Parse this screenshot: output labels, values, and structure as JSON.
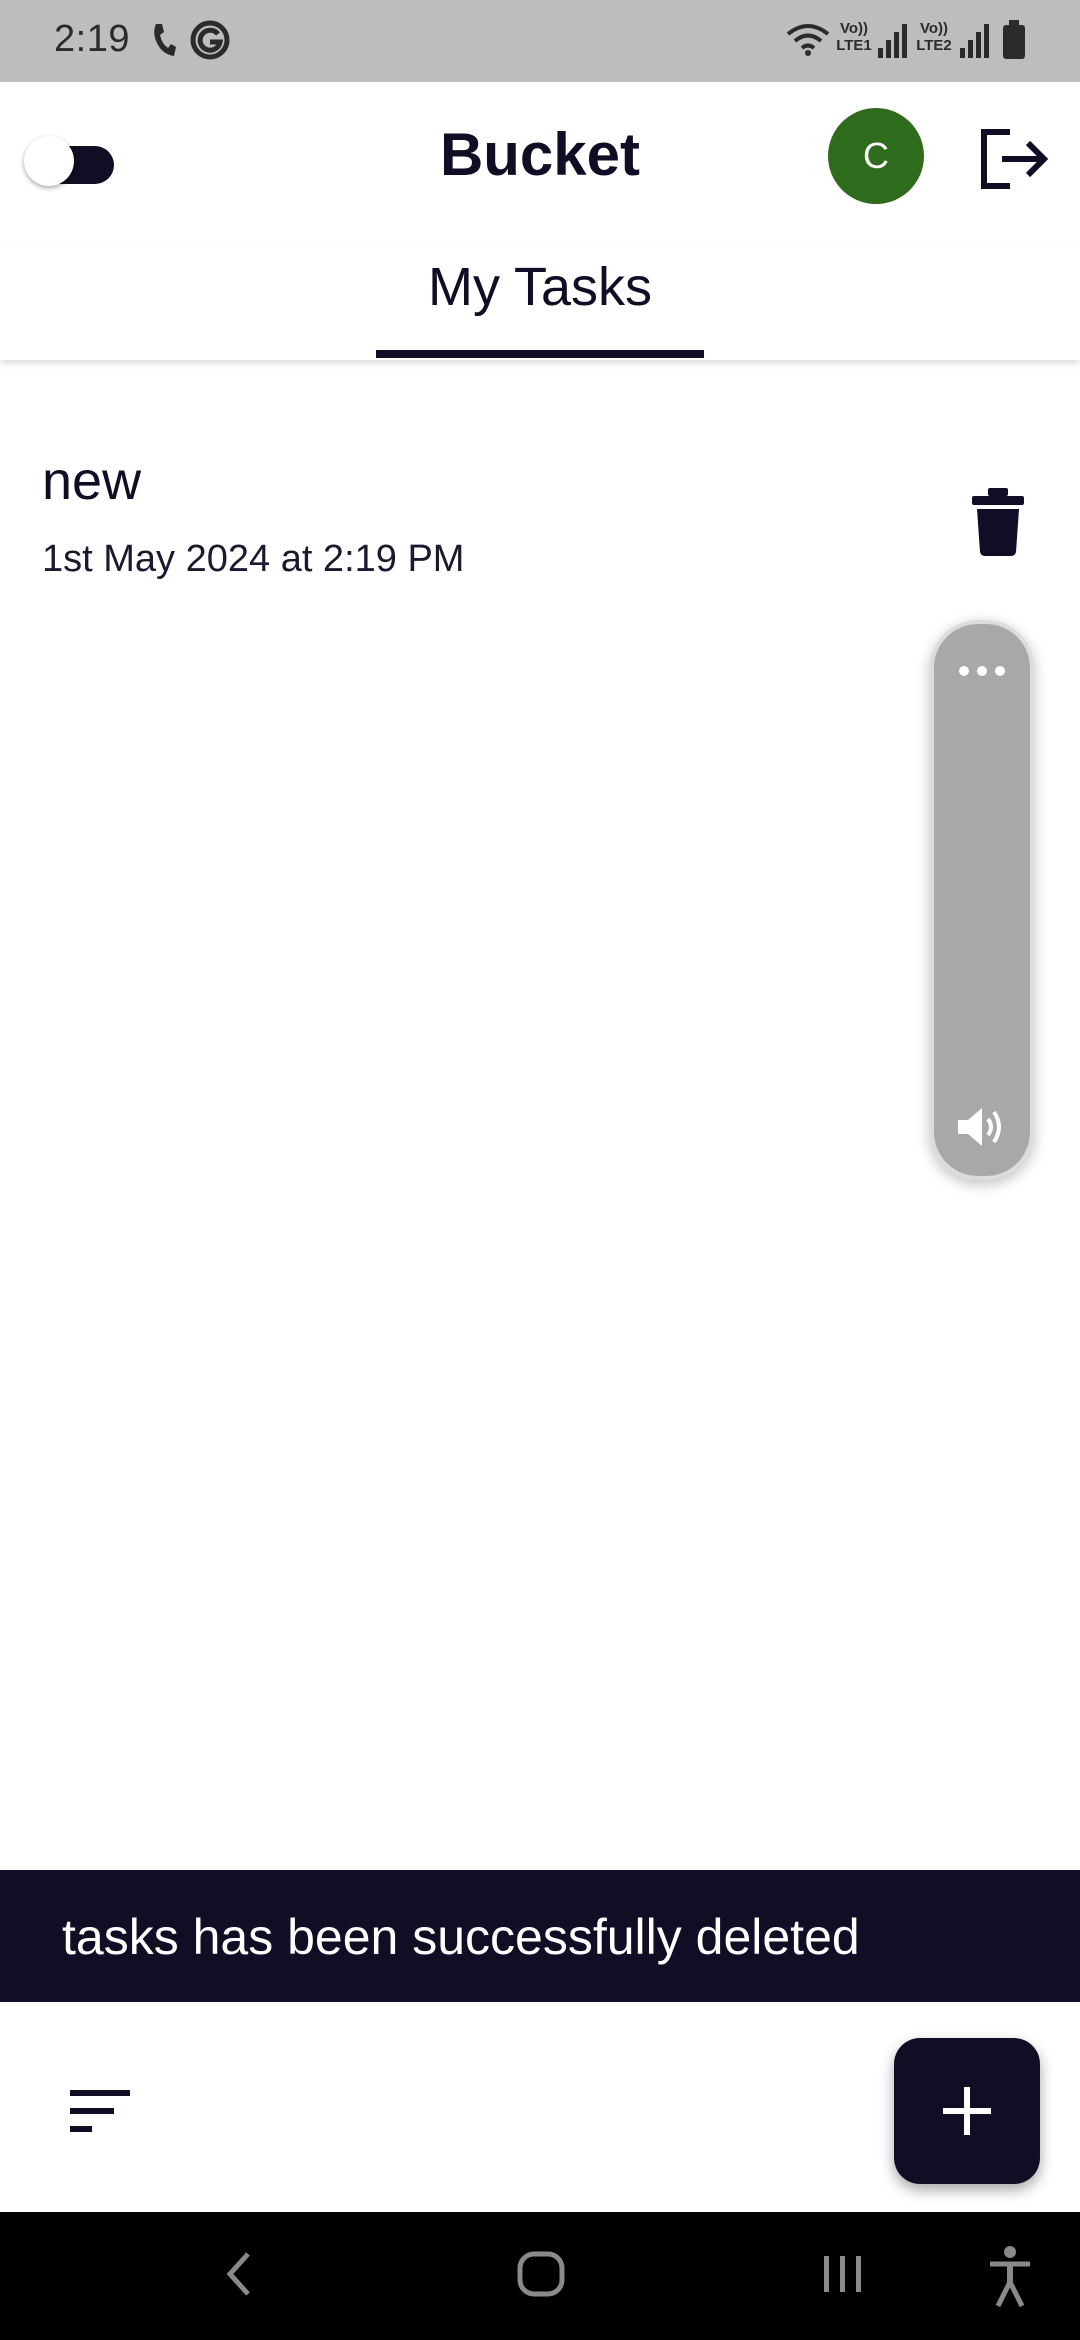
{
  "status_bar": {
    "time": "2:19",
    "left_icons": [
      "phone-call-icon",
      "g-circle-icon"
    ],
    "right_icons": [
      "wifi-icon",
      "volte-lte1-icon",
      "signal-icon",
      "volte-lte2-icon",
      "signal-icon",
      "battery-icon"
    ],
    "sim1_top": "Vo))",
    "sim1_bottom": "LTE1",
    "sim2_top": "Vo))",
    "sim2_bottom": "LTE2"
  },
  "app_bar": {
    "title": "Bucket",
    "avatar_initial": "C",
    "avatar_color": "#2e6b1c",
    "theme_toggle_on": false
  },
  "tabs": [
    {
      "label": "My Tasks",
      "active": true
    }
  ],
  "tasks": [
    {
      "title": "new",
      "date": "1st May 2024 at 2:19 PM"
    }
  ],
  "volume_overlay": {
    "icons": [
      "more-dots-icon",
      "speaker-icon"
    ]
  },
  "snackbar": {
    "message": "tasks has been successfully deleted"
  },
  "bottom_bar": {
    "sort_icon": "sort-icon",
    "fab_icon": "plus-icon"
  },
  "nav_bar": {
    "buttons": [
      "back-icon",
      "home-icon",
      "recents-icon",
      "accessibility-icon"
    ]
  },
  "colors": {
    "primary_dark": "#0f0e24",
    "status_bar_bg": "#bdbdbd",
    "snackbar_bg": "#0f0e24",
    "nav_bar_bg": "#000000"
  }
}
